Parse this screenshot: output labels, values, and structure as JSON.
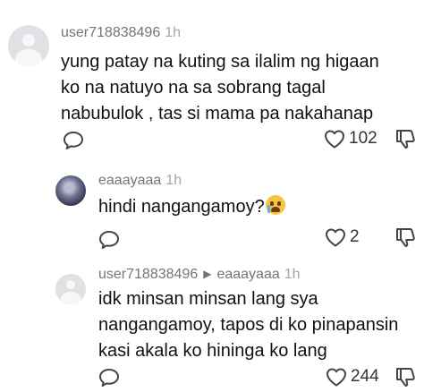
{
  "comments": [
    {
      "username": "user718838496",
      "time": "1h",
      "text_lines": [
        "yung patay na kuting sa ilalim ng higaan",
        "ko na natuyo na sa sobrang tagal",
        "nabubulok , tas si mama pa nakahanap"
      ],
      "likes": "102"
    },
    {
      "username": "eaaayaaa",
      "time": "1h",
      "text": "hindi nangangamoy?",
      "emoji": "crying-face-emoji",
      "likes": "2"
    },
    {
      "username": "user718838496",
      "reply_to": "eaaayaaa",
      "time": "1h",
      "text_lines": [
        "idk minsan minsan lang sya",
        "nangangamoy, tapos di ko pinapansin",
        "kasi akala ko hininga ko lang"
      ],
      "likes": "244"
    }
  ],
  "icons": {
    "reply": "speech-bubble-icon",
    "like": "heart-icon",
    "dislike": "thumbs-down-icon"
  },
  "colors": {
    "username": "#757575",
    "timestamp": "#a6a6a6",
    "text": "#111111",
    "avatar_bg": "#dfe1e4"
  }
}
